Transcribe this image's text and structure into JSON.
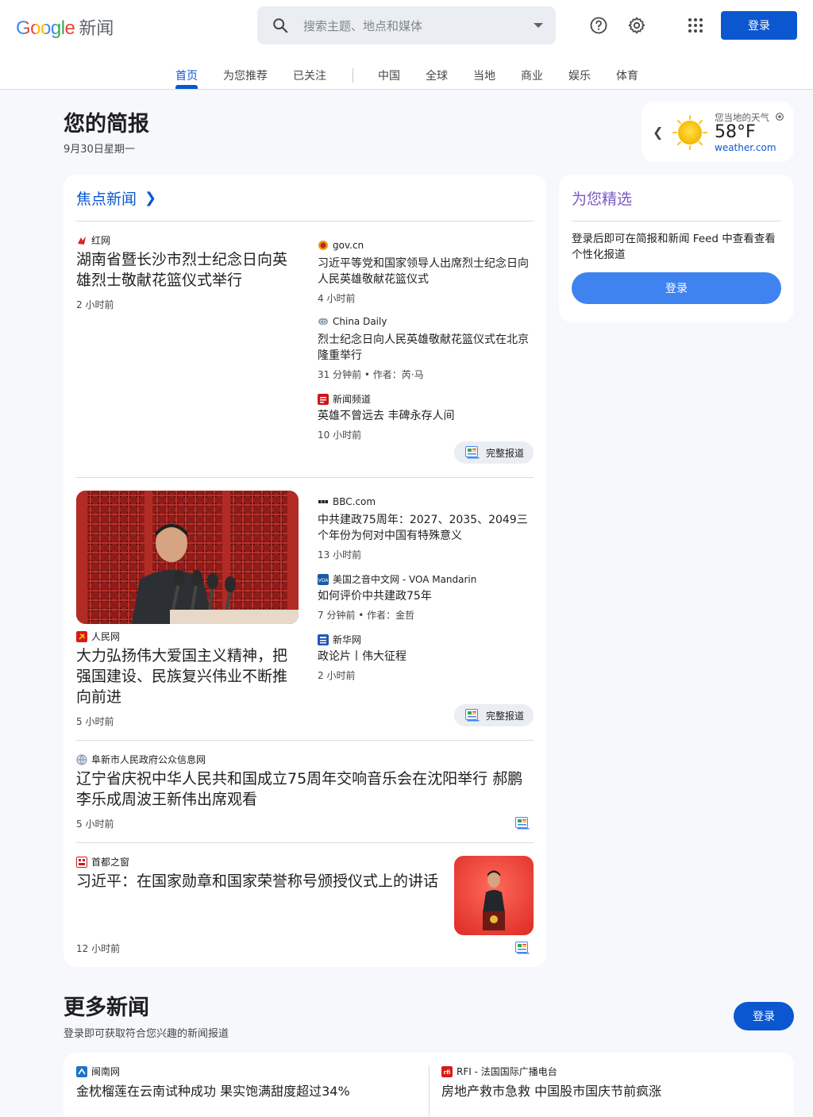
{
  "header": {
    "logo_text": "Google",
    "logo_suffix": "新闻",
    "search_placeholder": "搜索主题、地点和媒体",
    "signin_label": "登录"
  },
  "tabs": [
    {
      "label": "首页",
      "active": true
    },
    {
      "label": "为您推荐"
    },
    {
      "label": "已关注"
    },
    {
      "label": "中国"
    },
    {
      "label": "全球"
    },
    {
      "label": "当地"
    },
    {
      "label": "商业"
    },
    {
      "label": "娱乐"
    },
    {
      "label": "体育"
    }
  ],
  "briefing": {
    "title": "您的简报",
    "date": "9月30日星期一"
  },
  "weather": {
    "label": "您当地的天气",
    "temp": "58°F",
    "source": "weather.com"
  },
  "top_stories": {
    "title": "焦点新闻",
    "full_coverage_label": "完整报道",
    "clusters": [
      {
        "main": {
          "publisher": "红网",
          "headline": "湖南省暨长沙市烈士纪念日向英雄烈士敬献花篮仪式举行",
          "time": "2 小时前"
        },
        "related": [
          {
            "publisher": "gov.cn",
            "headline": "习近平等党和国家领导人出席烈士纪念日向人民英雄敬献花篮仪式",
            "time": "4 小时前"
          },
          {
            "publisher": "China Daily",
            "headline": "烈士纪念日向人民英雄敬献花篮仪式在北京隆重举行",
            "time": "31 分钟前 • 作者：芮·马"
          },
          {
            "publisher": "新闻频道",
            "headline": "英雄不曾远去 丰碑永存人间",
            "time": "10 小时前"
          }
        ]
      },
      {
        "main": {
          "publisher": "人民网",
          "headline": "大力弘扬伟大爱国主义精神，把强国建设、民族复兴伟业不断推向前进",
          "time": "5 小时前"
        },
        "related": [
          {
            "publisher": "BBC.com",
            "headline": "中共建政75周年：2027、2035、2049三个年份为何对中国有特殊意义",
            "time": "13 小时前"
          },
          {
            "publisher": "美国之音中文网 - VOA Mandarin",
            "headline": "如何评价中共建政75年",
            "time": "7 分钟前 • 作者：金哲"
          },
          {
            "publisher": "新华网",
            "headline": "政论片丨伟大征程",
            "time": "2 小时前"
          }
        ]
      },
      {
        "main": {
          "publisher": "阜新市人民政府公众信息网",
          "headline": "辽宁省庆祝中华人民共和国成立75周年交响音乐会在沈阳举行 郝鹏李乐成周波王新伟出席观看",
          "time": "5 小时前"
        }
      },
      {
        "main": {
          "publisher": "首都之窗",
          "headline": "习近平：在国家勋章和国家荣誉称号颁授仪式上的讲话",
          "time": "12 小时前"
        }
      }
    ]
  },
  "picks": {
    "title": "为您精选",
    "text": "登录后即可在简报和新闻 Feed 中查看查看个性化报道",
    "button": "登录"
  },
  "more_news": {
    "title": "更多新闻",
    "subtitle": "登录即可获取符合您兴趣的新闻报道",
    "button": "登录",
    "items": [
      {
        "publisher": "闽南网",
        "headline": "金枕榴莲在云南试种成功 果实饱满甜度超过34%"
      },
      {
        "publisher": "RFI - 法国国际广播电台",
        "headline": "房地产救市急救 中国股市国庆节前疯涨"
      }
    ]
  },
  "colors": {
    "accent": "#0b57d0",
    "picks_title": "#7e57c2",
    "background": "#f6f8fc"
  }
}
